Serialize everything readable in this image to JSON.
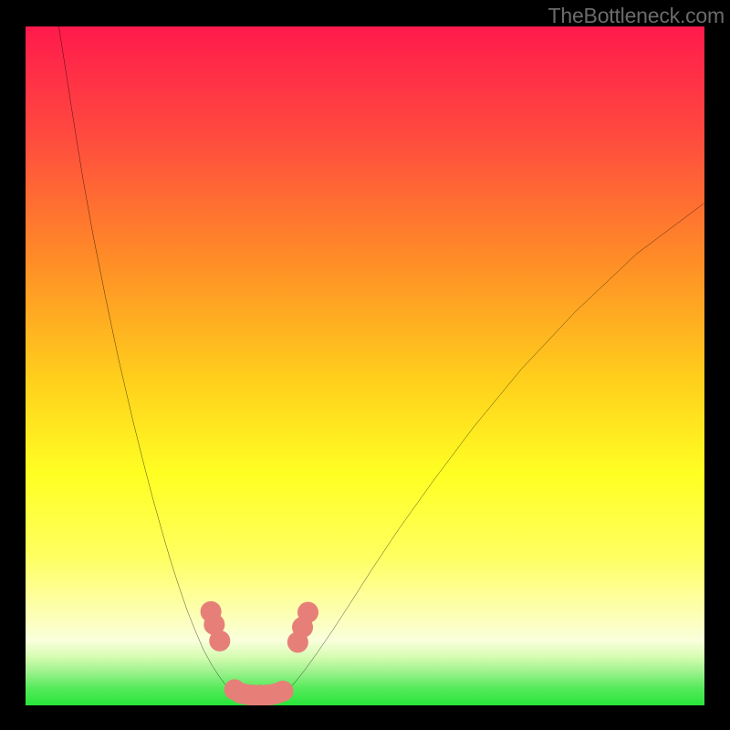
{
  "watermark": {
    "text": "TheBottleneck.com"
  },
  "colors": {
    "frame": "#000000",
    "curve": "#000000",
    "marker_fill": "#e77f79",
    "marker_stroke": "#e77f79",
    "green_band_top": "#9ff28e",
    "green_band_bottom": "#28e53a"
  },
  "chart_data": {
    "type": "line",
    "title": "",
    "xlabel": "",
    "ylabel": "",
    "xlim": [
      0,
      100
    ],
    "ylim": [
      0,
      100
    ],
    "gradient_stops": [
      {
        "offset": 0.0,
        "color": "#ff1a4c"
      },
      {
        "offset": 0.16,
        "color": "#ff4a3f"
      },
      {
        "offset": 0.34,
        "color": "#ff8b27"
      },
      {
        "offset": 0.52,
        "color": "#ffcf1c"
      },
      {
        "offset": 0.66,
        "color": "#ffff23"
      },
      {
        "offset": 0.78,
        "color": "#ffff60"
      },
      {
        "offset": 0.86,
        "color": "#fdffae"
      },
      {
        "offset": 0.905,
        "color": "#f9ffdc"
      },
      {
        "offset": 0.928,
        "color": "#d7fcb2"
      },
      {
        "offset": 0.95,
        "color": "#9ff28e"
      },
      {
        "offset": 0.975,
        "color": "#55ea5a"
      },
      {
        "offset": 1.0,
        "color": "#28e53a"
      }
    ],
    "series": [
      {
        "name": "left-branch",
        "x": [
          4.9,
          6.0,
          7.2,
          8.5,
          10.0,
          11.8,
          13.7,
          15.8,
          17.3,
          18.6,
          20.0,
          21.3,
          22.6,
          23.8,
          25.0,
          26.2,
          27.4,
          28.5,
          29.4,
          30.3,
          31.2,
          32.1
        ],
        "y": [
          100,
          93.0,
          85.3,
          77.3,
          69.0,
          60.0,
          51.0,
          42.0,
          36.0,
          31.0,
          26.0,
          21.5,
          17.5,
          14.0,
          11.0,
          8.2,
          6.0,
          4.3,
          3.1,
          2.2,
          1.5,
          1.0
        ]
      },
      {
        "name": "right-branch",
        "x": [
          37.1,
          38.4,
          39.7,
          41.2,
          43.0,
          45.2,
          47.8,
          51.0,
          55.0,
          60.0,
          66.0,
          73.0,
          81.0,
          90.0,
          100.0
        ],
        "y": [
          1.0,
          2.0,
          3.4,
          5.3,
          7.8,
          11.0,
          15.0,
          20.0,
          26.0,
          33.0,
          41.0,
          49.5,
          58.0,
          66.5,
          74.0
        ]
      },
      {
        "name": "valley-floor",
        "x": [
          30.0,
          31.0,
          32.0,
          33.0,
          34.0,
          35.0,
          36.0,
          37.0,
          38.0,
          39.0
        ],
        "y": [
          1.7,
          1.2,
          0.9,
          0.75,
          0.7,
          0.7,
          0.75,
          0.9,
          1.2,
          1.9
        ]
      }
    ],
    "markers": [
      {
        "x": 27.3,
        "y": 13.8
      },
      {
        "x": 27.8,
        "y": 11.9
      },
      {
        "x": 28.6,
        "y": 9.5
      },
      {
        "x": 30.8,
        "y": 2.3
      },
      {
        "x": 31.7,
        "y": 1.8
      },
      {
        "x": 32.6,
        "y": 1.6
      },
      {
        "x": 33.5,
        "y": 1.5
      },
      {
        "x": 34.5,
        "y": 1.5
      },
      {
        "x": 35.5,
        "y": 1.5
      },
      {
        "x": 36.3,
        "y": 1.6
      },
      {
        "x": 37.1,
        "y": 1.8
      },
      {
        "x": 37.9,
        "y": 2.1
      },
      {
        "x": 40.1,
        "y": 9.3
      },
      {
        "x": 40.8,
        "y": 11.5
      },
      {
        "x": 41.6,
        "y": 13.7
      }
    ]
  }
}
